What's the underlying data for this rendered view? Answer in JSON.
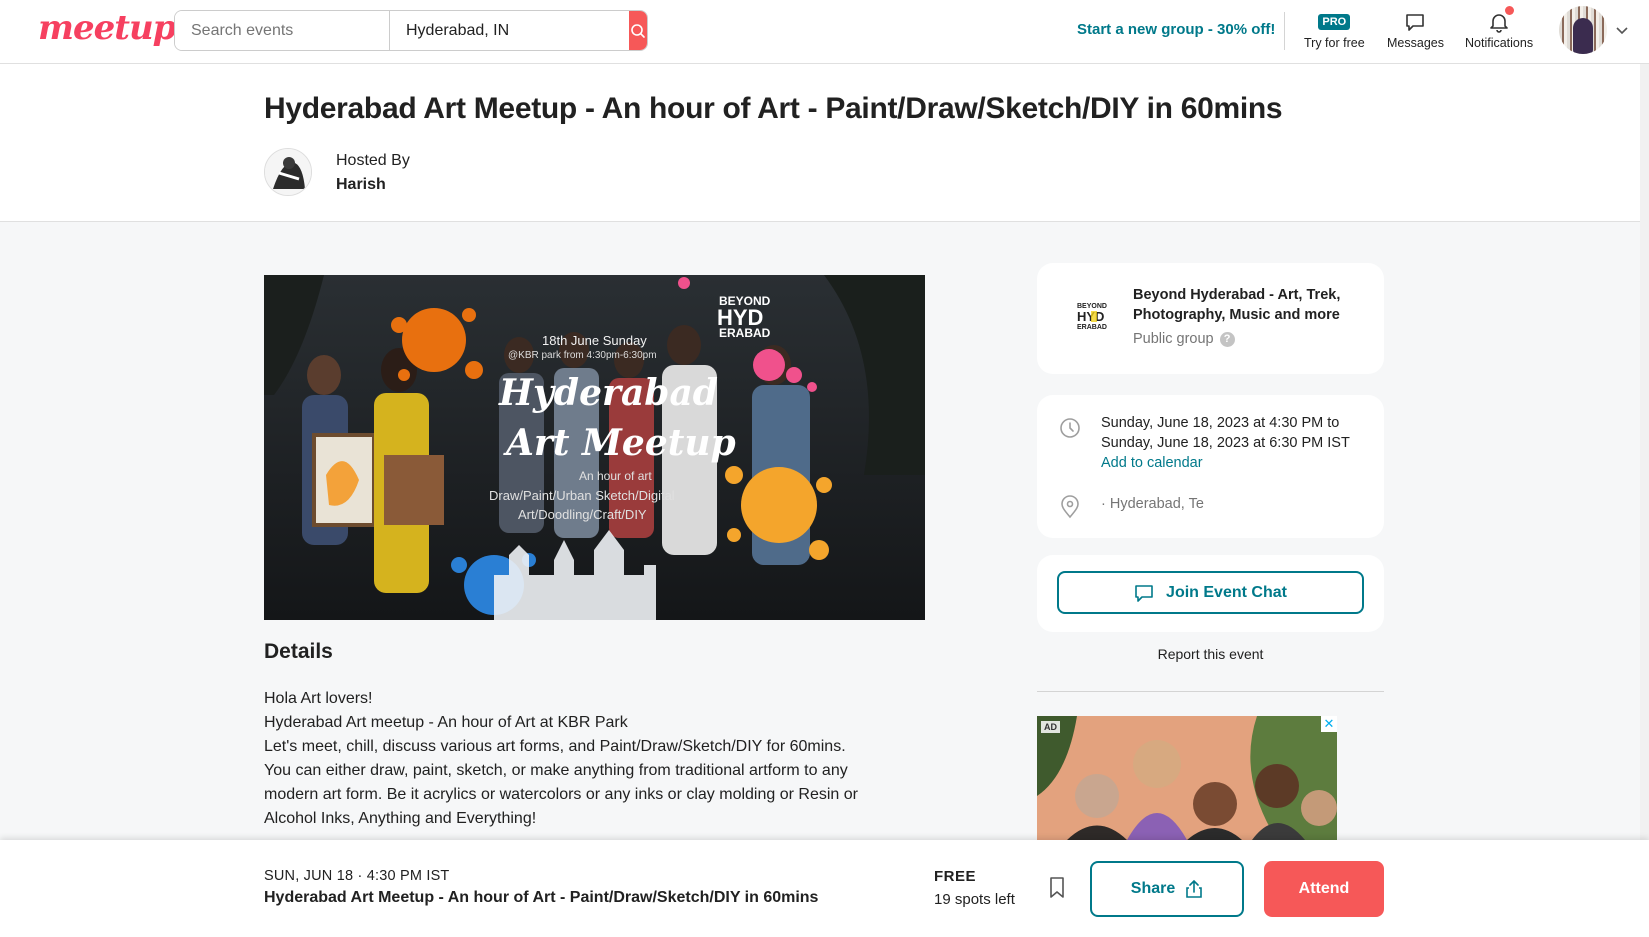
{
  "header": {
    "logo": "meetup",
    "search_placeholder": "Search events",
    "location_value": "Hyderabad, IN",
    "promo": "Start a new group - 30% off!",
    "pro_badge": "PRO",
    "pro_label": "Try for free",
    "messages_label": "Messages",
    "notifications_label": "Notifications"
  },
  "event": {
    "title": "Hyderabad Art Meetup - An hour of Art - Paint/Draw/Sketch/DIY in 60mins",
    "hosted_by_label": "Hosted By",
    "host_name": "Harish"
  },
  "hero": {
    "date_text": "18th June Sunday",
    "time_text": "@KBR park from 4:30pm-6:30pm",
    "logo_line1": "BEYOND",
    "logo_line2": "HYD",
    "logo_line3": "ERABAD",
    "headline1": "Hyderabad",
    "headline2": "Art Meetup",
    "sub1": "An hour of art",
    "sub2": "Draw/Paint/Urban Sketch/Digital",
    "sub3": "Art/Doodling/Craft/DIY"
  },
  "details": {
    "heading": "Details",
    "lines": [
      "Hola Art lovers!",
      "Hyderabad Art meetup - An hour of Art at KBR Park",
      "Let's meet, chill, discuss various art forms, and Paint/Draw/Sketch/DIY for 60mins.",
      "You can either draw, paint, sketch, or make anything from traditional artform to any",
      "modern art form. Be it acrylics or watercolors or any inks or clay molding or Resin or",
      "Alcohol Inks, Anything and Everything!"
    ]
  },
  "group": {
    "name": "Beyond Hyderabad - Art, Trek, Photography, Music and more",
    "type": "Public group",
    "help": "?"
  },
  "when": {
    "start": "Sunday, June 18, 2023 at 4:30 PM to",
    "end": "Sunday, June 18, 2023 at 6:30 PM IST",
    "add_calendar": "Add to calendar",
    "venue": "· Hyderabad, Te"
  },
  "chat": {
    "label": "Join Event Chat"
  },
  "report": {
    "label": "Report this event"
  },
  "ad": {
    "label": "AD",
    "close": "✕"
  },
  "bottom": {
    "date": "SUN, JUN 18 · 4:30 PM IST",
    "title": "Hyderabad Art Meetup - An hour of Art - Paint/Draw/Sketch/DIY in 60mins",
    "price": "FREE",
    "spots": "19 spots left",
    "share": "Share",
    "attend": "Attend"
  },
  "colors": {
    "brand": "#f64060",
    "accent": "#00798a",
    "attend": "#f65858"
  }
}
